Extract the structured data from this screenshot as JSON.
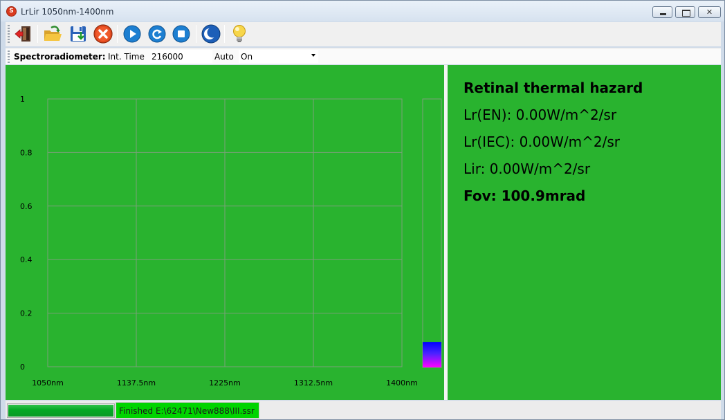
{
  "window": {
    "title": "LrLir 1050nm-1400nm",
    "app_icon": "S"
  },
  "toolbar": {
    "buttons": [
      {
        "icon": "exit-door-icon"
      },
      {
        "icon": "open-folder-icon"
      },
      {
        "icon": "save-disk-icon"
      },
      {
        "icon": "stop-red-x-icon"
      },
      {
        "icon": "play-icon"
      },
      {
        "icon": "refresh-icon"
      },
      {
        "icon": "stop-square-icon"
      },
      {
        "icon": "dark-mode-moon-icon"
      },
      {
        "icon": "lightbulb-icon"
      }
    ]
  },
  "spectro": {
    "label": "Spectroradiometer:",
    "int_time_label": "Int. Time",
    "int_time_value": "216000",
    "auto_label": "Auto",
    "auto_value": "On"
  },
  "chart_data": {
    "type": "line",
    "x_ticks": [
      "1050nm",
      "1137.5nm",
      "1225nm",
      "1312.5nm",
      "1400nm"
    ],
    "y_ticks": [
      "0",
      "0.2",
      "0.4",
      "0.6",
      "0.8",
      "1"
    ],
    "xlim": [
      1050,
      1400
    ],
    "ylim": [
      0,
      1
    ],
    "grid": true,
    "series": [],
    "color_bar": {
      "colors": [
        "#0000ff",
        "#ff00ff"
      ],
      "level": 0.095
    }
  },
  "info": {
    "title": "Retinal thermal hazard",
    "lr_en": "Lr(EN): 0.00W/m^2/sr",
    "lr_iec": "Lr(IEC): 0.00W/m^2/sr",
    "lir": "Lir: 0.00W/m^2/sr",
    "fov": "Fov: 100.9mrad"
  },
  "status": {
    "progress": 1.0,
    "text": "Finished E:\\62471\\New888\\III.ssr"
  },
  "colors": {
    "panel_bg": "#29b32f",
    "grid": "#7aa07a",
    "status_bg": "#00d400"
  }
}
